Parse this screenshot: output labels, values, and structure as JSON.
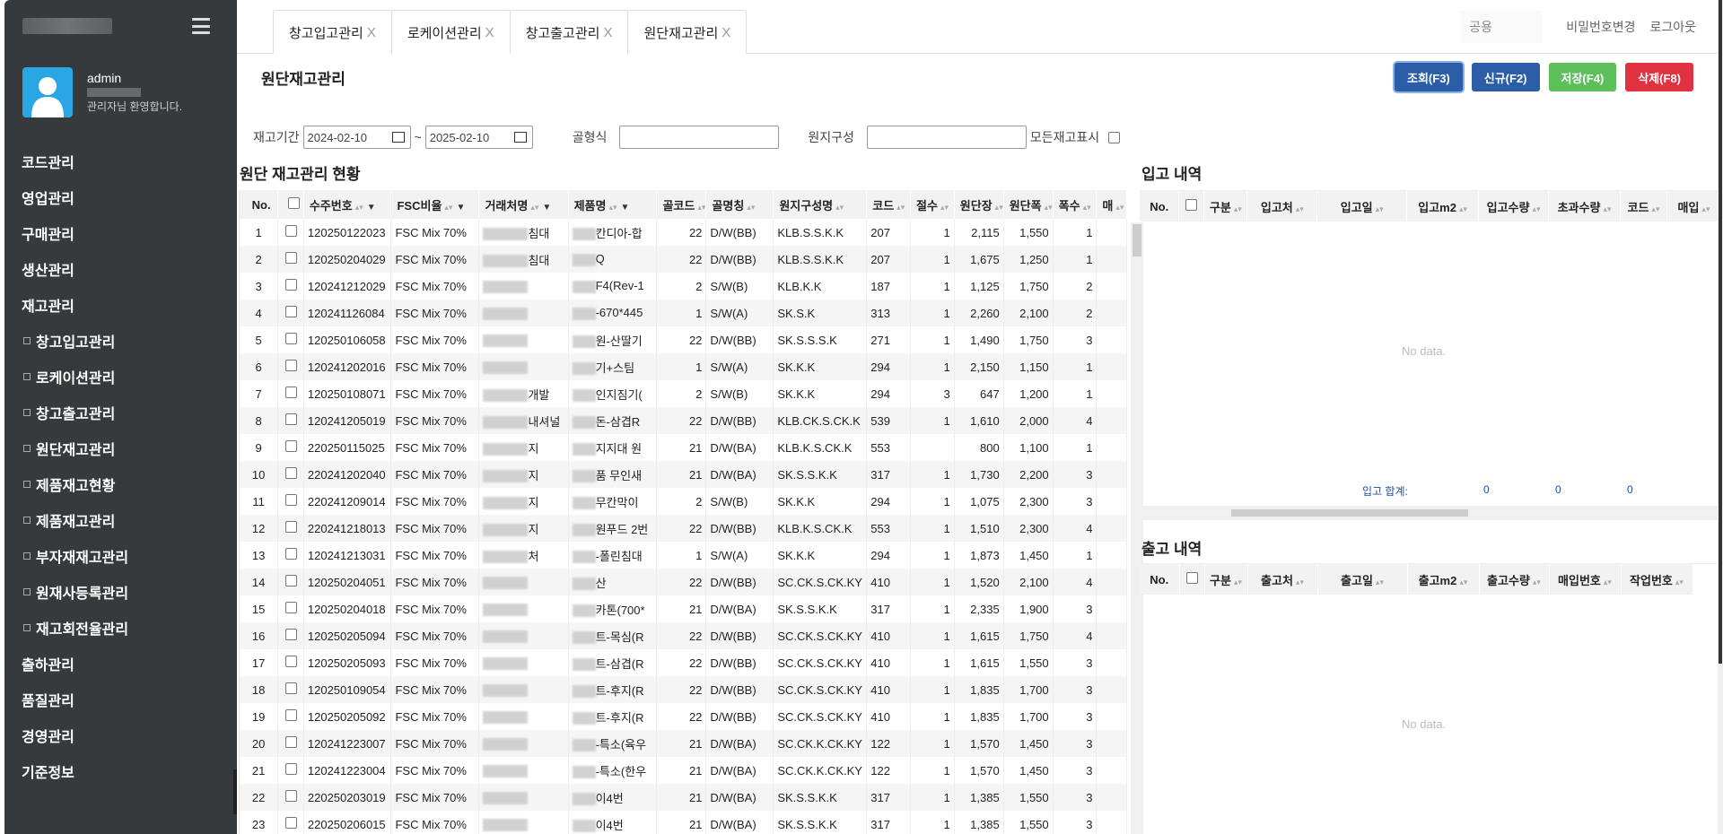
{
  "sidebar": {
    "user": {
      "name": "admin",
      "welcome": "관리자님 환영합니다."
    },
    "menu": [
      {
        "label": "코드관리",
        "sub": false
      },
      {
        "label": "영업관리",
        "sub": false
      },
      {
        "label": "구매관리",
        "sub": false
      },
      {
        "label": "생산관리",
        "sub": false
      },
      {
        "label": "재고관리",
        "sub": false
      },
      {
        "label": "창고입고관리",
        "sub": true
      },
      {
        "label": "로케이션관리",
        "sub": true
      },
      {
        "label": "창고출고관리",
        "sub": true
      },
      {
        "label": "원단재고관리",
        "sub": true
      },
      {
        "label": "제품재고현황",
        "sub": true
      },
      {
        "label": "제품재고관리",
        "sub": true
      },
      {
        "label": "부자재재고관리",
        "sub": true
      },
      {
        "label": "원재사등록관리",
        "sub": true
      },
      {
        "label": "재고회전율관리",
        "sub": true
      },
      {
        "label": "출하관리",
        "sub": false
      },
      {
        "label": "품질관리",
        "sub": false
      },
      {
        "label": "경영관리",
        "sub": false
      },
      {
        "label": "기준정보",
        "sub": false
      }
    ]
  },
  "tabs": [
    "창고입고관리",
    "로케이션관리",
    "창고출고관리",
    "원단재고관리"
  ],
  "tab_close": "X",
  "top_right": {
    "company": "공용",
    "change_password": "비밀번호변경",
    "logout": "로그아웃"
  },
  "page_title": "원단재고관리",
  "buttons": {
    "search": "조회(F3)",
    "new": "신규(F2)",
    "save": "저장(F4)",
    "delete": "삭제(F8)"
  },
  "filters": {
    "period_label": "재고기간",
    "date_from": "2024-02-10",
    "tilde": "~",
    "date_to": "2025-02-10",
    "flute_label": "골형식",
    "paper_label": "원지구성",
    "show_all_label": "모든재고표시"
  },
  "left_title": "원단 재고관리 현황",
  "left_columns": [
    "No.",
    "",
    "수주번호",
    "FSC비율",
    "거래처명",
    "제품명",
    "골코드",
    "골명칭",
    "원지구성명",
    "코드",
    "절수",
    "원단장",
    "원단폭",
    "폭수",
    "매"
  ],
  "rows": [
    {
      "no": "1",
      "order": "120250122023",
      "fsc": "FSC Mix 70%",
      "cust": "침대",
      "prod": "칸디아-합",
      "fcode": "22",
      "fname": "D/W(BB)",
      "paper": "KLB.S.S.K.K",
      "code": "207",
      "cut": "1",
      "len": "2,115",
      "wid": "1,550",
      "cnt": "1"
    },
    {
      "no": "2",
      "order": "120250204029",
      "fsc": "FSC Mix 70%",
      "cust": "침대",
      "prod": "Q",
      "fcode": "22",
      "fname": "D/W(BB)",
      "paper": "KLB.S.S.K.K",
      "code": "207",
      "cut": "1",
      "len": "1,675",
      "wid": "1,250",
      "cnt": "1"
    },
    {
      "no": "3",
      "order": "120241212029",
      "fsc": "FSC Mix 70%",
      "cust": "",
      "prod": "F4(Rev-1",
      "fcode": "2",
      "fname": "S/W(B)",
      "paper": "KLB.K.K",
      "code": "187",
      "cut": "1",
      "len": "1,125",
      "wid": "1,750",
      "cnt": "2"
    },
    {
      "no": "4",
      "order": "120241126084",
      "fsc": "FSC Mix 70%",
      "cust": "",
      "prod": "-670*445",
      "fcode": "1",
      "fname": "S/W(A)",
      "paper": "SK.S.K",
      "code": "313",
      "cut": "1",
      "len": "2,260",
      "wid": "2,100",
      "cnt": "2"
    },
    {
      "no": "5",
      "order": "120250106058",
      "fsc": "FSC Mix 70%",
      "cust": "",
      "prod": "원-산딸기",
      "fcode": "22",
      "fname": "D/W(BB)",
      "paper": "SK.S.S.S.K",
      "code": "271",
      "cut": "1",
      "len": "1,490",
      "wid": "1,750",
      "cnt": "3"
    },
    {
      "no": "6",
      "order": "120241202016",
      "fsc": "FSC Mix 70%",
      "cust": "",
      "prod": "기+스팀",
      "fcode": "1",
      "fname": "S/W(A)",
      "paper": "SK.K.K",
      "code": "294",
      "cut": "1",
      "len": "2,150",
      "wid": "1,150",
      "cnt": "1"
    },
    {
      "no": "7",
      "order": "120250108071",
      "fsc": "FSC Mix 70%",
      "cust": "개발",
      "prod": "인지짐기(",
      "fcode": "2",
      "fname": "S/W(B)",
      "paper": "SK.K.K",
      "code": "294",
      "cut": "3",
      "len": "647",
      "wid": "1,200",
      "cnt": "1"
    },
    {
      "no": "8",
      "order": "120241205019",
      "fsc": "FSC Mix 70%",
      "cust": "내셔널",
      "prod": "돈-삼겹R",
      "fcode": "22",
      "fname": "D/W(BB)",
      "paper": "KLB.CK.S.CK.K",
      "code": "539",
      "cut": "1",
      "len": "1,610",
      "wid": "2,000",
      "cnt": "4"
    },
    {
      "no": "9",
      "order": "220250115025",
      "fsc": "FSC Mix 70%",
      "cust": "지",
      "prod": "지지대 원",
      "fcode": "21",
      "fname": "D/W(BA)",
      "paper": "KLB.K.S.CK.K",
      "code": "553",
      "cut": "",
      "len": "800",
      "wid": "1,100",
      "cnt": "1"
    },
    {
      "no": "10",
      "order": "220241202040",
      "fsc": "FSC Mix 70%",
      "cust": "지",
      "prod": "품 무인새",
      "fcode": "21",
      "fname": "D/W(BA)",
      "paper": "SK.S.S.K.K",
      "code": "317",
      "cut": "1",
      "len": "1,730",
      "wid": "2,200",
      "cnt": "3"
    },
    {
      "no": "11",
      "order": "220241209014",
      "fsc": "FSC Mix 70%",
      "cust": "지",
      "prod": "무칸막이",
      "fcode": "2",
      "fname": "S/W(B)",
      "paper": "SK.K.K",
      "code": "294",
      "cut": "1",
      "len": "1,075",
      "wid": "2,300",
      "cnt": "3"
    },
    {
      "no": "12",
      "order": "220241218013",
      "fsc": "FSC Mix 70%",
      "cust": "지",
      "prod": "원푸드 2번",
      "fcode": "22",
      "fname": "D/W(BB)",
      "paper": "KLB.K.S.CK.K",
      "code": "553",
      "cut": "1",
      "len": "1,510",
      "wid": "2,300",
      "cnt": "4"
    },
    {
      "no": "13",
      "order": "120241213031",
      "fsc": "FSC Mix 70%",
      "cust": "처",
      "prod": "-폴린침대",
      "fcode": "1",
      "fname": "S/W(A)",
      "paper": "SK.K.K",
      "code": "294",
      "cut": "1",
      "len": "1,873",
      "wid": "1,450",
      "cnt": "1"
    },
    {
      "no": "14",
      "order": "120250204051",
      "fsc": "FSC Mix 70%",
      "cust": "",
      "prod": "산",
      "fcode": "22",
      "fname": "D/W(BB)",
      "paper": "SC.CK.S.CK.KY",
      "code": "410",
      "cut": "1",
      "len": "1,520",
      "wid": "2,100",
      "cnt": "4"
    },
    {
      "no": "15",
      "order": "120250204018",
      "fsc": "FSC Mix 70%",
      "cust": "",
      "prod": "카톤(700*",
      "fcode": "21",
      "fname": "D/W(BA)",
      "paper": "SK.S.S.K.K",
      "code": "317",
      "cut": "1",
      "len": "2,335",
      "wid": "1,900",
      "cnt": "3"
    },
    {
      "no": "16",
      "order": "120250205094",
      "fsc": "FSC Mix 70%",
      "cust": "",
      "prod": "트-목심(R",
      "fcode": "22",
      "fname": "D/W(BB)",
      "paper": "SC.CK.S.CK.KY",
      "code": "410",
      "cut": "1",
      "len": "1,615",
      "wid": "1,750",
      "cnt": "4"
    },
    {
      "no": "17",
      "order": "120250205093",
      "fsc": "FSC Mix 70%",
      "cust": "",
      "prod": "트-삼겹(R",
      "fcode": "22",
      "fname": "D/W(BB)",
      "paper": "SC.CK.S.CK.KY",
      "code": "410",
      "cut": "1",
      "len": "1,615",
      "wid": "1,550",
      "cnt": "3"
    },
    {
      "no": "18",
      "order": "120250109054",
      "fsc": "FSC Mix 70%",
      "cust": "",
      "prod": "트-후지(R",
      "fcode": "22",
      "fname": "D/W(BB)",
      "paper": "SC.CK.S.CK.KY",
      "code": "410",
      "cut": "1",
      "len": "1,835",
      "wid": "1,700",
      "cnt": "3"
    },
    {
      "no": "19",
      "order": "120250205092",
      "fsc": "FSC Mix 70%",
      "cust": "",
      "prod": "트-후지(R",
      "fcode": "22",
      "fname": "D/W(BB)",
      "paper": "SC.CK.S.CK.KY",
      "code": "410",
      "cut": "1",
      "len": "1,835",
      "wid": "1,700",
      "cnt": "3"
    },
    {
      "no": "20",
      "order": "120241223007",
      "fsc": "FSC Mix 70%",
      "cust": "",
      "prod": "-특소(육우",
      "fcode": "21",
      "fname": "D/W(BA)",
      "paper": "SC.CK.K.CK.KY",
      "code": "122",
      "cut": "1",
      "len": "1,570",
      "wid": "1,450",
      "cnt": "3"
    },
    {
      "no": "21",
      "order": "120241223004",
      "fsc": "FSC Mix 70%",
      "cust": "",
      "prod": "-특소(한우",
      "fcode": "21",
      "fname": "D/W(BA)",
      "paper": "SC.CK.K.CK.KY",
      "code": "122",
      "cut": "1",
      "len": "1,570",
      "wid": "1,450",
      "cnt": "3"
    },
    {
      "no": "22",
      "order": "220250203019",
      "fsc": "FSC Mix 70%",
      "cust": "",
      "prod": "이4번",
      "fcode": "21",
      "fname": "D/W(BA)",
      "paper": "SK.S.S.K.K",
      "code": "317",
      "cut": "1",
      "len": "1,385",
      "wid": "1,550",
      "cnt": "3"
    },
    {
      "no": "23",
      "order": "220250206015",
      "fsc": "FSC Mix 70%",
      "cust": "",
      "prod": "이4번",
      "fcode": "21",
      "fname": "D/W(BA)",
      "paper": "SK.S.S.K.K",
      "code": "317",
      "cut": "1",
      "len": "1,385",
      "wid": "1,550",
      "cnt": "3"
    }
  ],
  "in_title": "입고 내역",
  "in_columns": [
    "No.",
    "",
    "구분",
    "입고처",
    "입고일",
    "입고m2",
    "입고수량",
    "초과수량",
    "코드",
    "매입"
  ],
  "in_nodata": "No data.",
  "in_sum": {
    "label": "입고 합계:",
    "v1": "0",
    "v2": "0",
    "v3": "0"
  },
  "out_title": "출고 내역",
  "out_columns": [
    "No.",
    "",
    "구분",
    "출고처",
    "출고일",
    "출고m2",
    "출고수량",
    "매입번호",
    "작업번호"
  ],
  "out_nodata": "No data."
}
